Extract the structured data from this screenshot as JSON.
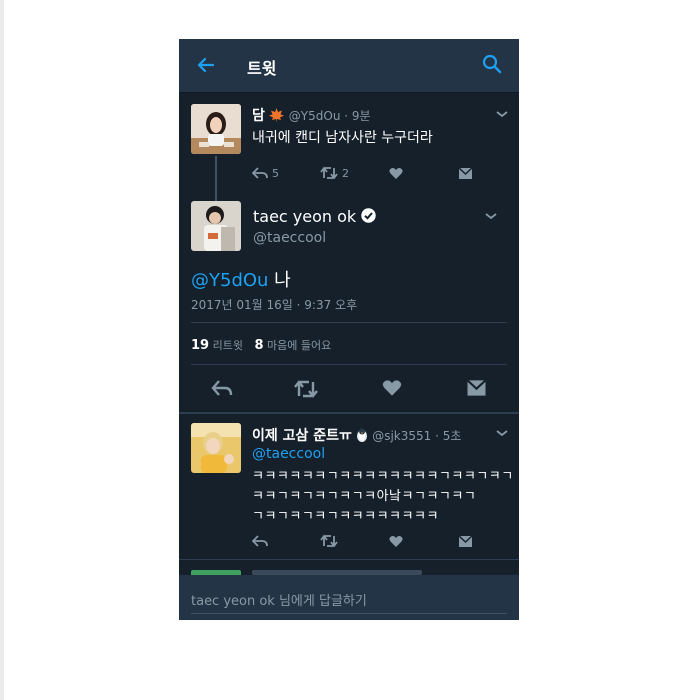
{
  "header": {
    "title": "트윗"
  },
  "tweet1": {
    "name": "담",
    "handle": "@Y5dOu · 9분",
    "text": "내귀에 캔디 남자사란 누구더라",
    "reply_count": "5",
    "retweet_count": "2"
  },
  "main_tweet": {
    "name": "taec yeon ok",
    "handle": "@taeccool",
    "mention": "@Y5dOu",
    "text": " 나",
    "timestamp": "2017년 01월 16일 · 9:37 오후",
    "retweets_num": "19",
    "retweets_label": "리트윗",
    "likes_num": "8",
    "likes_label": "마음에 들어요"
  },
  "reply_tweet": {
    "name": "이제 고삼 준트ㅠ",
    "handle": "@sjk3551 · 5초",
    "mention": "@taeccool",
    "line1": "ㅋㅋㅋㅋㅋㅋㄱㅋㅋㅋㅋㅋㅋㅋㅋㄱㅋㅋㄱㅋㄱ",
    "line2": "ㅋㅋㄱㅋㄱㅋㄱㅋㄱㅋ아낰ㅋㄱㅋㄱㅋㄱ",
    "line3": "ㄱㅋㄱㅋㄱㅋㄱㅋㅋㅋㅋㅋㅋㅋㅋ"
  },
  "reply_bar": {
    "placeholder": "taec yeon ok 님에게 답글하기"
  },
  "colors": {
    "background": "#15202b",
    "header": "#243447",
    "accent": "#1da1f2",
    "muted": "#8899a6"
  }
}
